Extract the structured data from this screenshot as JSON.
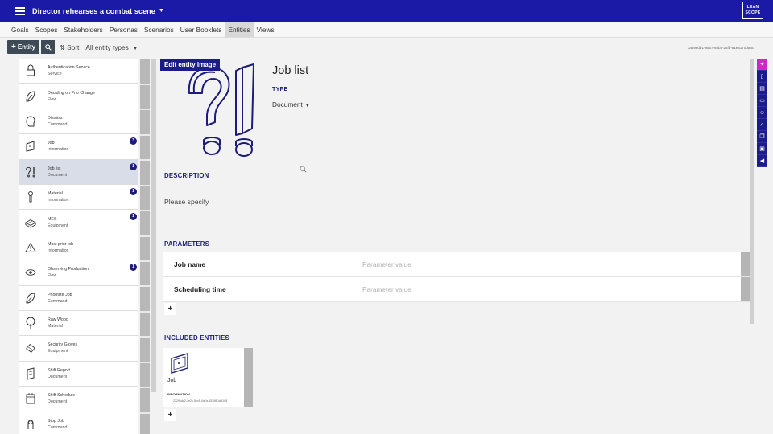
{
  "header": {
    "project_title": "Director rehearses a combat scene",
    "logo_text_line1": "LEAN",
    "logo_text_line2": "SCOPE"
  },
  "nav": {
    "tabs": [
      {
        "label": "Goals"
      },
      {
        "label": "Scopes"
      },
      {
        "label": "Stakeholders"
      },
      {
        "label": "Personas"
      },
      {
        "label": "Scenarios"
      },
      {
        "label": "User Booklets"
      },
      {
        "label": "Entities",
        "active": true
      },
      {
        "label": "Views"
      }
    ]
  },
  "toolbar": {
    "add_entity_label": "Entity",
    "sort_label": "Sort",
    "filter_label": "All entity types",
    "id_text": "ca69edb1-95b7-65b3-25fb-61e5170d5ac"
  },
  "entities": [
    {
      "name": "Authentication Service",
      "type": "Service",
      "icon": "padlock-icon"
    },
    {
      "name": "Deciding on Prio Change",
      "type": "Flow",
      "icon": "leaf-icon"
    },
    {
      "name": "Dismiss",
      "type": "Command",
      "icon": "head-icon"
    },
    {
      "name": "Job",
      "type": "Information",
      "icon": "monitor-icon",
      "badge": "3"
    },
    {
      "name": "Job list",
      "type": "Document",
      "icon": "question-exclamation-icon",
      "badge": "1",
      "selected": true
    },
    {
      "name": "Material",
      "type": "Information",
      "icon": "wrench-icon",
      "badge": "1"
    },
    {
      "name": "MES",
      "type": "Equipment",
      "icon": "machine-icon",
      "badge": "1"
    },
    {
      "name": "Most prior job",
      "type": "Information",
      "icon": "warning-icon"
    },
    {
      "name": "Observing Production",
      "type": "Flow",
      "icon": "eye-icon",
      "badge": "1"
    },
    {
      "name": "Prioritize Job",
      "type": "Command",
      "icon": "leaf-icon"
    },
    {
      "name": "Raw Wood",
      "type": "Material",
      "icon": "tree-icon"
    },
    {
      "name": "Security Gloves",
      "type": "Equipment",
      "icon": "glove-icon"
    },
    {
      "name": "Shift Report",
      "type": "Document",
      "icon": "report-icon"
    },
    {
      "name": "Shift Schedule",
      "type": "Document",
      "icon": "calendar-icon"
    },
    {
      "name": "Stop Job",
      "type": "Command",
      "icon": "hand-icon"
    }
  ],
  "detail": {
    "edit_image_label": "Edit entity image",
    "title": "Job list",
    "type_label": "TYPE",
    "type_value": "Document",
    "description_label": "DESCRIPTION",
    "description_text": "Please specify",
    "parameters_label": "PARAMETERS",
    "parameters": [
      {
        "name": "Job name",
        "placeholder": "Parameter value"
      },
      {
        "name": "Scheduling time",
        "placeholder": "Parameter value"
      }
    ],
    "add_symbol": "+",
    "included_label": "INCLUDED ENTITIES",
    "included": [
      {
        "name": "Job",
        "type": "INFORMATION",
        "id": "22291dc2-1e2c-5ec5-0a7a-65398f1dd198"
      }
    ]
  },
  "right_rail": {
    "icons": [
      "bulb-icon",
      "phone-icon",
      "document-icon",
      "layers-icon",
      "smile-icon",
      "search-icon",
      "copy-icon",
      "image-icon",
      "megaphone-icon"
    ]
  },
  "colors": {
    "primary": "#1a1aa6",
    "accent_pink": "#d026c9",
    "badge": "#1c1c7a"
  }
}
